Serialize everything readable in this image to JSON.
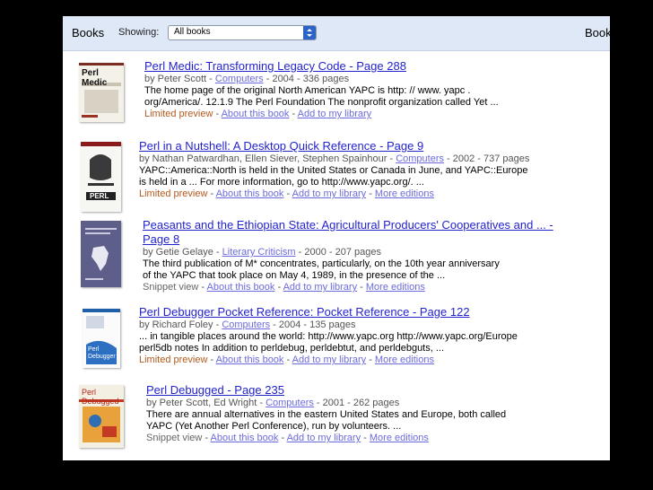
{
  "topbar": {
    "title": "Books",
    "showing_label": "Showing:",
    "select_value": "All books",
    "right_label": "Book"
  },
  "results": [
    {
      "title": "Perl Medic: Transforming Legacy Code - Page 288",
      "meta_prefix": "by Peter Scott - ",
      "category": "Computers",
      "meta_suffix": " - 2004 - 336 pages",
      "snippet": [
        "The home page of the original North American YAPC is http: // www. yapc .",
        "org/America/. 12.1.9 The Perl Foundation The nonprofit organization called Yet ..."
      ],
      "preview": "Limited preview",
      "about": "About this book",
      "add": "Add to my library",
      "more": "",
      "cover_title": "Perl Medic"
    },
    {
      "title": "Perl in a Nutshell: A Desktop Quick Reference - Page 9",
      "meta_prefix": "by Nathan Patwardhan, Ellen Siever, Stephen Spainhour - ",
      "category": "Computers",
      "meta_suffix": " - 2002 - 737 pages",
      "snippet": [
        "YAPC::America::North is held in the United States or Canada in June, and YAPC::Europe",
        "is held in a ... For more information, go to http://www.yapc.org/. ..."
      ],
      "preview": "Limited preview",
      "about": "About this book",
      "add": "Add to my library",
      "more": "More editions",
      "cover_title": "PERL"
    },
    {
      "title": "Peasants and the Ethiopian State: Agricultural Producers' Cooperatives and ... -",
      "title2": "Page 8",
      "meta_prefix": "by Getie Gelaye - ",
      "category": "Literary Criticism",
      "meta_suffix": " - 2000 - 207 pages",
      "snippet": [
        "The third publication of M* concentrates, particularly, on the 10th year anniversary",
        "of the YAPC that took place on May 4, 1989, in the presence of the ..."
      ],
      "preview": "Snippet view",
      "about": "About this book",
      "add": "Add to my library",
      "more": "More editions"
    },
    {
      "title": "Perl Debugger Pocket Reference: Pocket Reference - Page 122",
      "meta_prefix": "by Richard Foley - ",
      "category": "Computers",
      "meta_suffix": " - 2004 - 135 pages",
      "snippet": [
        "... in tangible places around the world: http://www.yapc.org http://www.yapc.org/Europe",
        "perl5db notes In addition to perldebug, perldebtut, and perldebguts, ..."
      ],
      "preview": "Limited preview",
      "about": "About this book",
      "add": "Add to my library",
      "more": "More editions",
      "cover_title": "Perl Debugger"
    },
    {
      "title": "Perl Debugged - Page 235",
      "meta_prefix": "by Peter Scott, Ed Wright - ",
      "category": "Computers",
      "meta_suffix": " - 2001 - 262 pages",
      "snippet": [
        "There are annual alternatives in the eastern United States and Europe, both called",
        "YAPC (Yet Another Perl Conference), run by volunteers. ..."
      ],
      "preview": "Snippet view",
      "about": "About this book",
      "add": "Add to my library",
      "more": "More editions",
      "cover_title": "Perl Debugged"
    }
  ]
}
